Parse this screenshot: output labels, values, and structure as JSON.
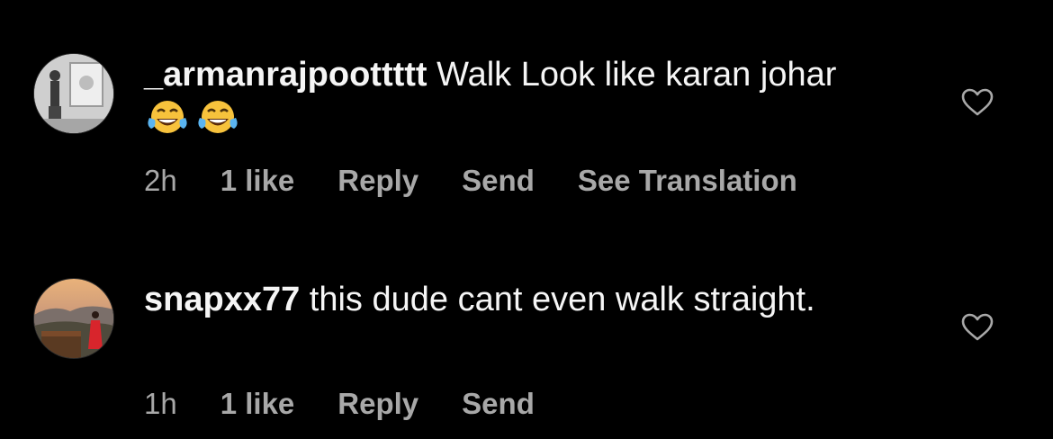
{
  "comments": [
    {
      "username": "_armanrajpoottttt",
      "text": " Walk Look like karan johar",
      "emojis": [
        "face-with-tears-of-joy",
        "face-with-tears-of-joy"
      ],
      "time": "2h",
      "likes": "1 like",
      "reply_label": "Reply",
      "send_label": "Send",
      "translate_label": "See Translation"
    },
    {
      "username": "snapxx77",
      "text": " this dude cant even walk straight.",
      "time": "1h",
      "likes": "1 like",
      "reply_label": "Reply",
      "send_label": "Send"
    }
  ],
  "colors": {
    "background": "#000000",
    "primary_text": "#f5f5f5",
    "secondary_text": "#a8a8a8"
  },
  "icons": {
    "like": "heart-outline-icon"
  }
}
